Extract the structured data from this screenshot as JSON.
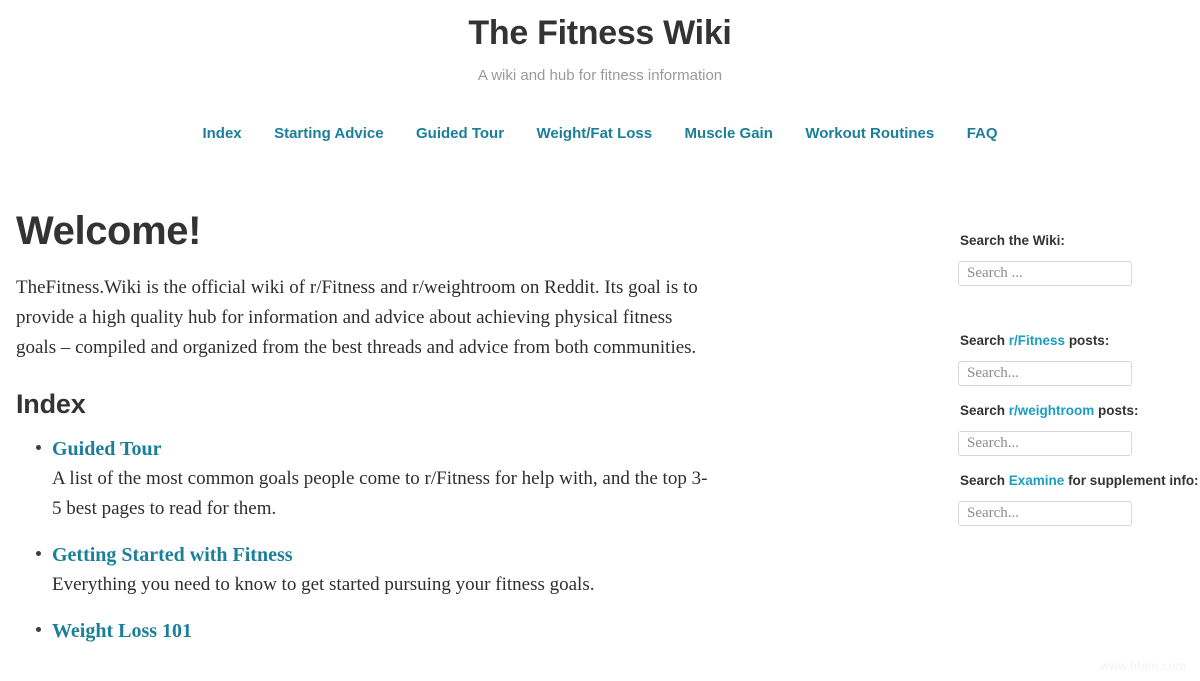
{
  "header": {
    "title": "The Fitness Wiki",
    "subtitle": "A wiki and hub for fitness information"
  },
  "nav": {
    "items": [
      {
        "label": "Index"
      },
      {
        "label": "Starting Advice"
      },
      {
        "label": "Guided Tour"
      },
      {
        "label": "Weight/Fat Loss"
      },
      {
        "label": "Muscle Gain"
      },
      {
        "label": "Workout Routines"
      },
      {
        "label": "FAQ"
      }
    ]
  },
  "main": {
    "welcome_heading": "Welcome!",
    "intro_paragraph": "TheFitness.Wiki is the official wiki of r/Fitness and r/weightroom on Reddit. Its goal is to provide a high quality hub for information and advice about achieving physical fitness goals – compiled and organized from the best threads and advice from both communities.",
    "index_heading": "Index",
    "index_items": [
      {
        "link": "Guided Tour",
        "description": "A list of the most common goals people come to r/Fitness for help with, and the top 3-5 best pages to read for them."
      },
      {
        "link": "Getting Started with Fitness",
        "description": "Everything you need to know to get started pursuing your fitness goals."
      },
      {
        "link": "Weight Loss 101",
        "description": ""
      }
    ]
  },
  "sidebar": {
    "wiki_search": {
      "label_prefix": "Search the Wiki:",
      "label_link": "",
      "label_suffix": "",
      "placeholder": "Search ...",
      "value": ""
    },
    "fitness_search": {
      "label_prefix": "Search ",
      "label_link": "r/Fitness",
      "label_suffix": " posts:",
      "placeholder": "Search...",
      "value": ""
    },
    "weightroom_search": {
      "label_prefix": "Search ",
      "label_link": "r/weightroom",
      "label_suffix": " posts:",
      "placeholder": "Search...",
      "value": ""
    },
    "examine_search": {
      "label_prefix": "Search ",
      "label_link": "Examine",
      "label_suffix": " for supplement info:",
      "placeholder": "Search...",
      "value": ""
    }
  },
  "watermark": {
    "text": "www.fifam.com"
  },
  "colors": {
    "link": "#1b7f99",
    "accent_link": "#1b9ec0",
    "heading": "#333333",
    "body_text": "#2e2e2e",
    "subtitle": "#9a9a9a",
    "input_border": "#d6d6d6",
    "background": "#ffffff"
  }
}
